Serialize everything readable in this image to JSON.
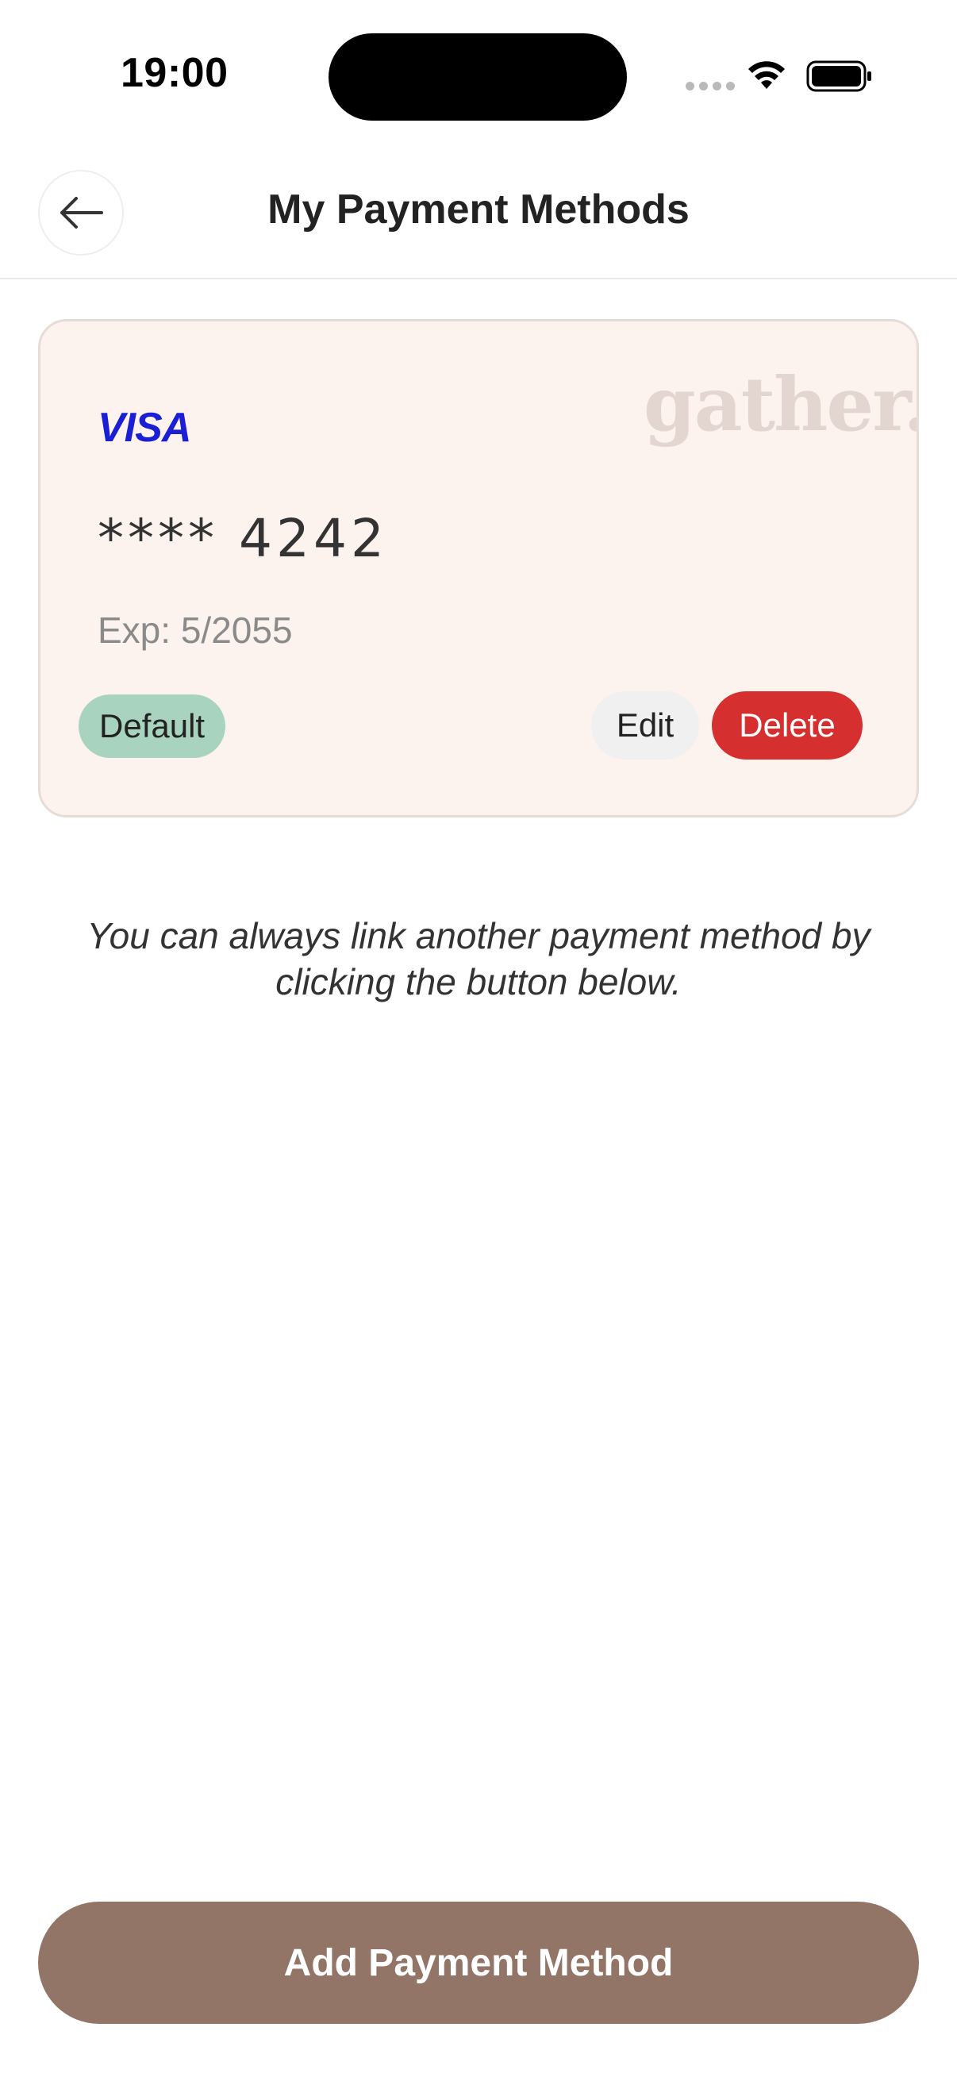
{
  "status_bar": {
    "time": "19:00"
  },
  "header": {
    "title": "My Payment Methods",
    "back_icon": "arrow-left-icon"
  },
  "card": {
    "brand": "VISA",
    "brand_color": "#1a1fd6",
    "watermark": "gather.",
    "number": "**** 4242",
    "expiry": "Exp: 5/2055",
    "default_label": "Default",
    "edit_label": "Edit",
    "delete_label": "Delete",
    "colors": {
      "background": "#fcf2ee",
      "default_badge": "#a8d3bf",
      "delete": "#d62f2f"
    }
  },
  "hint": "You can always link another payment method by clicking the button below.",
  "footer": {
    "add_label": "Add Payment Method",
    "accent": "#927567"
  }
}
